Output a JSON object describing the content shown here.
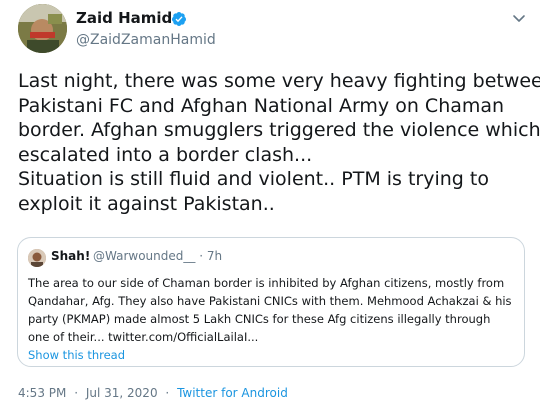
{
  "tweet": {
    "display_name": "Zaid Hamid",
    "handle": "@ZaidZamanHamid",
    "body_lines": [
      "Last night, there was some very heavy fighting between",
      "Pakistani FC and Afghan National Army on Chaman",
      "border. Afghan smugglers triggered the violence which",
      "escalated into a border clash...",
      "Situation is still fluid and violent.. PTM is trying to",
      "exploit it against Pakistan.."
    ],
    "time": "4:53 PM",
    "date": "Jul 31, 2020",
    "source": "Twitter for Android",
    "separator": "·",
    "icons": {
      "verified": "verified-badge-icon",
      "menu": "chevron-down-icon"
    },
    "colors": {
      "link": "#1b95e0",
      "secondary": "#657786",
      "verified": "#1da1f2"
    }
  },
  "quoted": {
    "display_name": "Shah!",
    "handle": "@Warwounded__",
    "separator": "·",
    "age": "7h",
    "body_lines": [
      "The area to our side of Chaman border is inhibited by Afghan citizens, mostly from",
      "Qandahar, Afg. They also have Pakistani CNICs with them. Mehmood Achakzai & his",
      "party (PKMAP) made almost 5 Lakh CNICs for these Afg citizens illegally through",
      "one of their... twitter.com/OfficialLailaI..."
    ],
    "show_thread": "Show this thread"
  }
}
